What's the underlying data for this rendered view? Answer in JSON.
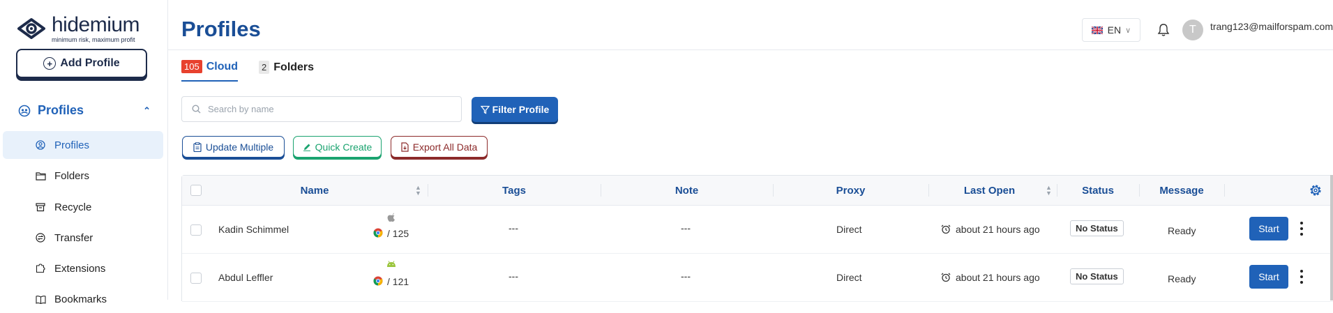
{
  "brand": {
    "name": "hidemium",
    "tagline": "minimum risk, maximum profit"
  },
  "sidebar": {
    "add_profile_label": "Add Profile",
    "section_label": "Profiles",
    "items": [
      {
        "label": "Profiles",
        "icon": "user-circle-icon",
        "active": true
      },
      {
        "label": "Folders",
        "icon": "folder-icon",
        "active": false
      },
      {
        "label": "Recycle",
        "icon": "recycle-bin-icon",
        "active": false
      },
      {
        "label": "Transfer",
        "icon": "transfer-icon",
        "active": false
      },
      {
        "label": "Extensions",
        "icon": "puzzle-icon",
        "active": false
      },
      {
        "label": "Bookmarks",
        "icon": "book-icon",
        "active": false
      }
    ]
  },
  "header": {
    "title": "Profiles",
    "language": "EN",
    "avatar_initial": "T",
    "user_email": "trang123@mailforspam.com"
  },
  "tabs": [
    {
      "count": "105",
      "label": "Cloud",
      "active": true
    },
    {
      "count": "2",
      "label": "Folders",
      "active": false
    }
  ],
  "toolbar": {
    "search_placeholder": "Search by name",
    "filter_label": "Filter Profile",
    "update_multiple_label": "Update Multiple",
    "quick_create_label": "Quick Create",
    "export_label": "Export All Data"
  },
  "table": {
    "columns": [
      "Name",
      "Tags",
      "Note",
      "Proxy",
      "Last Open",
      "Status",
      "Message"
    ],
    "rows": [
      {
        "name": "Kadin Schimmel",
        "os_icon": "apple-icon",
        "browser_version": "/ 125",
        "tags": "---",
        "note": "---",
        "proxy": "Direct",
        "last_open": "about 21 hours ago",
        "status": "No Status",
        "message": "Ready",
        "action_label": "Start"
      },
      {
        "name": "Abdul Leffler",
        "os_icon": "android-icon",
        "browser_version": "/ 121",
        "tags": "---",
        "note": "---",
        "proxy": "Direct",
        "last_open": "about 21 hours ago",
        "status": "No Status",
        "message": "Ready",
        "action_label": "Start"
      }
    ]
  },
  "colors": {
    "primary": "#2062b8",
    "heading": "#1a4e96",
    "brand_dark": "#1d2b4a",
    "count_badge": "#e8412e",
    "quick_create": "#1aa36f",
    "export": "#8c2a2a"
  }
}
